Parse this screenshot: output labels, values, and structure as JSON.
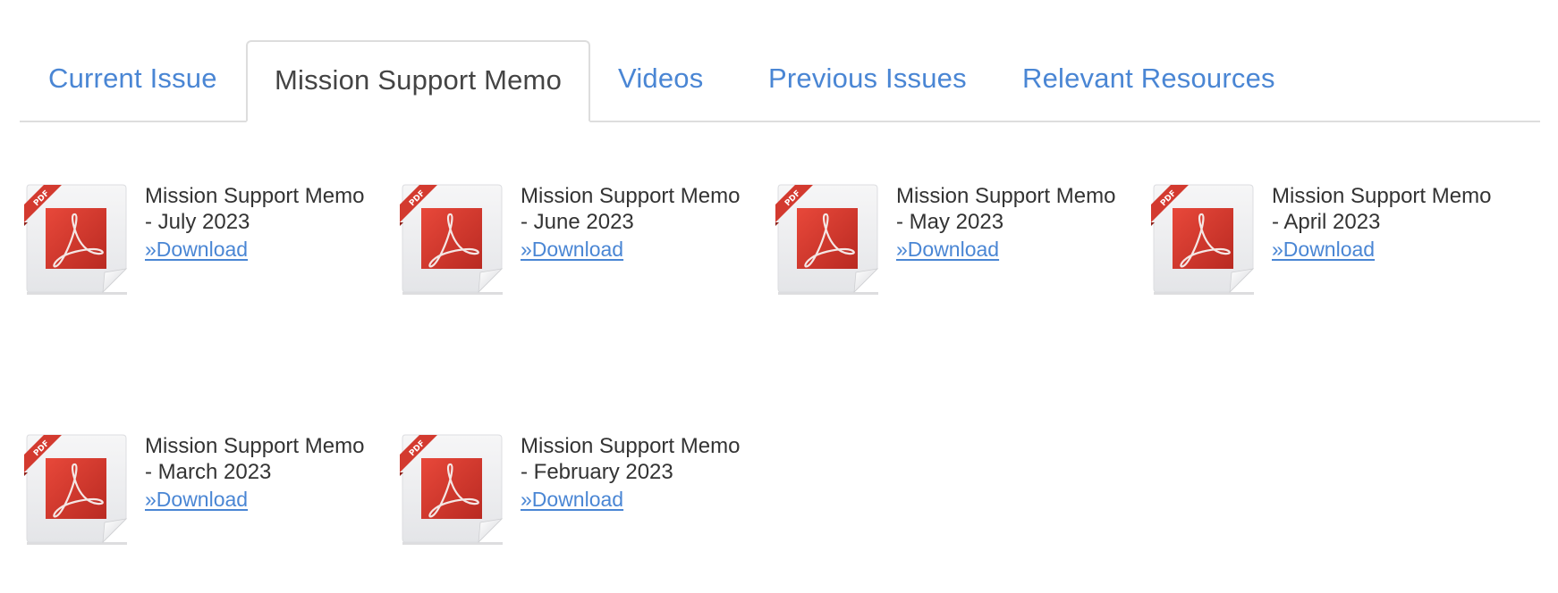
{
  "tabs": [
    {
      "label": "Current Issue",
      "active": false
    },
    {
      "label": "Mission Support Memo",
      "active": true
    },
    {
      "label": "Videos",
      "active": false
    },
    {
      "label": "Previous Issues",
      "active": false
    },
    {
      "label": "Relevant Resources",
      "active": false
    }
  ],
  "colors": {
    "link": "#4a86d4",
    "text": "#333333",
    "active_tab_text": "#444444",
    "border": "#dddddd",
    "pdf_red": "#d8382c"
  },
  "documents": [
    {
      "title_line1": "Mission Support Memo",
      "title_line2": "- July 2023",
      "link_label": "»Download",
      "icon": "pdf-file-icon",
      "icon_badge": "PDF"
    },
    {
      "title_line1": "Mission Support Memo",
      "title_line2": "- June 2023",
      "link_label": "»Download",
      "icon": "pdf-file-icon",
      "icon_badge": "PDF"
    },
    {
      "title_line1": "Mission Support Memo",
      "title_line2": "- May 2023",
      "link_label": "»Download",
      "icon": "pdf-file-icon",
      "icon_badge": "PDF"
    },
    {
      "title_line1": "Mission Support Memo",
      "title_line2": "- April 2023",
      "link_label": "»Download",
      "icon": "pdf-file-icon",
      "icon_badge": "PDF"
    },
    {
      "title_line1": "Mission Support Memo",
      "title_line2": "- March 2023",
      "link_label": "»Download",
      "icon": "pdf-file-icon",
      "icon_badge": "PDF"
    },
    {
      "title_line1": "Mission Support Memo",
      "title_line2": "- February 2023",
      "link_label": "»Download",
      "icon": "pdf-file-icon",
      "icon_badge": "PDF"
    }
  ]
}
